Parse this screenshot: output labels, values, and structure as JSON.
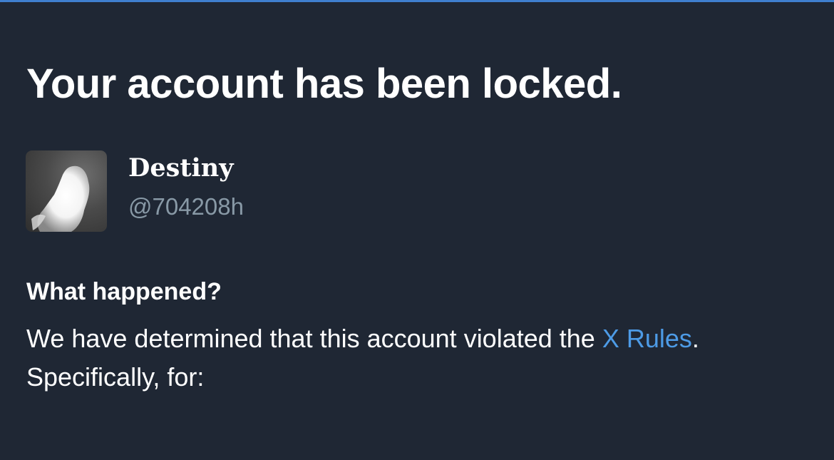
{
  "notice": {
    "title": "Your account has been locked."
  },
  "account": {
    "display_name": "Destiny",
    "handle": "@704208h",
    "avatar_icon": "profile-photo"
  },
  "details": {
    "heading": "What happened?",
    "text_before_link": "We have determined that this account violated the ",
    "link_text": "X Rules",
    "text_after_link": ". Specifically, for:"
  },
  "colors": {
    "background": "#1f2734",
    "accent_line": "#3f7fcf",
    "link": "#4d9be6",
    "handle_gray": "#8899a6"
  }
}
